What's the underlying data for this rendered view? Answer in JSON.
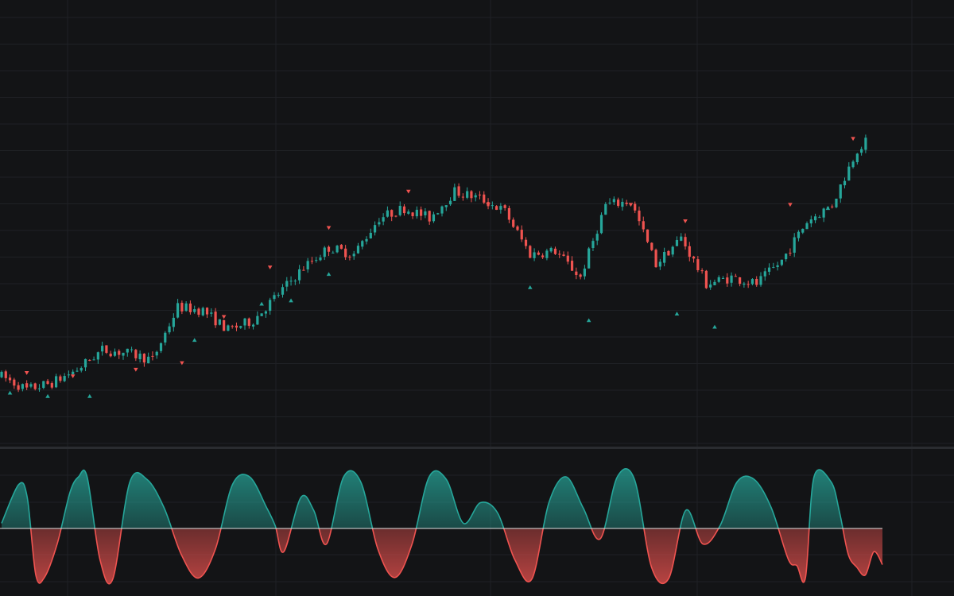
{
  "colors": {
    "background": "#131416",
    "grid": "#1f2125",
    "separator": "#2a2c30",
    "bull": "#26a69a",
    "bear": "#ef5350",
    "zero_line": "#e0e0e0"
  },
  "chart_data": [
    {
      "type": "candlestick",
      "title": "",
      "xlabel": "",
      "ylabel": "",
      "grid": true,
      "x_range": [
        0,
        210
      ],
      "ylim": [
        0,
        100
      ],
      "series": [
        {
          "x": [
            0,
            6,
            12,
            18,
            24,
            30,
            36,
            42,
            48,
            54,
            60,
            66,
            72,
            78,
            84,
            90,
            96,
            102,
            108,
            114,
            120,
            126,
            132,
            138,
            144,
            150,
            156,
            162,
            168,
            174,
            180,
            186,
            192,
            198,
            204,
            206
          ],
          "y": [
            10,
            6,
            8,
            12,
            18,
            17,
            15,
            31,
            30,
            24,
            27,
            35,
            43,
            49,
            47,
            58,
            61,
            58,
            66,
            64,
            60,
            47,
            48,
            40,
            62,
            63,
            44,
            52,
            38,
            40,
            38,
            45,
            57,
            62,
            79,
            81
          ]
        }
      ],
      "markers_up": [
        [
          2,
          5
        ],
        [
          11,
          4
        ],
        [
          21,
          4
        ],
        [
          46,
          21
        ],
        [
          62,
          32
        ],
        [
          69,
          33
        ],
        [
          78,
          41
        ],
        [
          126,
          37
        ],
        [
          140,
          27
        ],
        [
          161,
          29
        ],
        [
          170,
          25
        ],
        [
          197,
          61
        ]
      ],
      "markers_down": [
        [
          6,
          11
        ],
        [
          17,
          10
        ],
        [
          32,
          12
        ],
        [
          43,
          14
        ],
        [
          53,
          28
        ],
        [
          64,
          43
        ],
        [
          78,
          55
        ],
        [
          97,
          66
        ],
        [
          116,
          62
        ],
        [
          150,
          62
        ],
        [
          163,
          57
        ],
        [
          188,
          62
        ],
        [
          203,
          82
        ]
      ]
    },
    {
      "type": "area",
      "title": "",
      "xlabel": "",
      "ylabel": "",
      "grid": true,
      "baseline": 0,
      "ylim": [
        -1,
        1
      ],
      "series": [
        {
          "x": [
            0,
            4,
            6,
            8,
            10,
            13,
            16,
            18,
            20,
            23,
            26,
            30,
            34,
            38,
            42,
            46,
            50,
            54,
            58,
            62,
            64,
            66,
            70,
            73,
            76,
            80,
            84,
            88,
            92,
            96,
            100,
            104,
            108,
            112,
            116,
            120,
            124,
            128,
            132,
            136,
            140,
            144,
            148,
            152,
            156,
            160,
            164,
            168,
            172,
            176,
            180,
            184,
            186,
            188,
            190,
            194,
            196,
            198,
            200,
            202,
            204,
            206
          ],
          "y": [
            0.1,
            0.85,
            0.6,
            -0.9,
            -0.95,
            -0.3,
            0.7,
            1.0,
            1.0,
            -0.6,
            -0.98,
            0.9,
            0.95,
            0.4,
            -0.5,
            -0.96,
            -0.4,
            0.85,
            1.0,
            0.4,
            0.05,
            -0.45,
            0.6,
            0.35,
            -0.3,
            1.0,
            0.9,
            -0.4,
            -0.95,
            -0.3,
            1.0,
            0.95,
            0.1,
            0.5,
            0.3,
            -0.6,
            -0.98,
            0.5,
            1.0,
            0.4,
            -0.2,
            1.0,
            0.95,
            -0.75,
            -0.97,
            0.35,
            -0.3,
            0.05,
            0.9,
            0.95,
            0.4,
            -0.6,
            -0.72,
            -0.95,
            1.0,
            0.9,
            0.3,
            -0.5,
            -0.75,
            -0.9,
            -0.45,
            -0.7
          ]
        }
      ]
    }
  ]
}
